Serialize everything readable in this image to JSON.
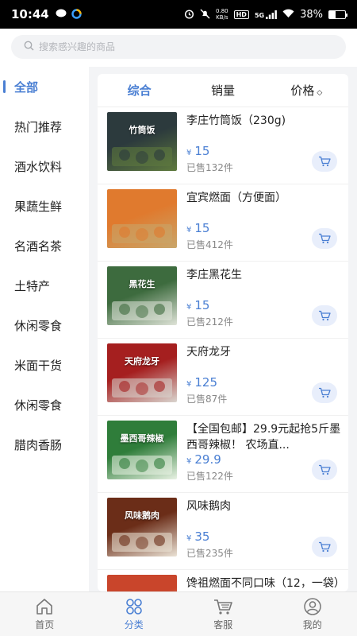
{
  "status_bar": {
    "time": "10:44",
    "net_speed_value": "0.80",
    "net_speed_unit": "KB/s",
    "hd_label": "HD",
    "signal_label": "5G",
    "battery": "38%",
    "battery_level": 0.38
  },
  "search": {
    "placeholder": "搜索感兴趣的商品"
  },
  "sidebar": {
    "items": [
      {
        "label": "全部",
        "active": true
      },
      {
        "label": "热门推荐"
      },
      {
        "label": "酒水饮料"
      },
      {
        "label": "果蔬生鲜"
      },
      {
        "label": "名酒名茶"
      },
      {
        "label": "土特产"
      },
      {
        "label": "休闲零食"
      },
      {
        "label": "米面干货"
      },
      {
        "label": "休闲零食"
      },
      {
        "label": "腊肉香肠"
      }
    ]
  },
  "sort_bar": {
    "tabs": [
      "综合",
      "销量",
      "价格"
    ],
    "price_caret": "◇"
  },
  "products": [
    {
      "title": "李庄竹筒饭（230g)",
      "currency": "¥",
      "price": "15",
      "sold": "已售132件",
      "img_text": "竹筒饭",
      "img_colors": [
        "#2c3a3d",
        "#5f7a3e"
      ]
    },
    {
      "title": "宜宾燃面（方便面）",
      "currency": "¥",
      "price": "15",
      "sold": "已售412件",
      "img_text": "",
      "img_colors": [
        "#e07a2e",
        "#c9a66a"
      ]
    },
    {
      "title": "李庄黑花生",
      "currency": "¥",
      "price": "15",
      "sold": "已售212件",
      "img_text": "黑花生",
      "img_colors": [
        "#3d6b3e",
        "#dfe3d8"
      ]
    },
    {
      "title": "天府龙牙",
      "currency": "¥",
      "price": "125",
      "sold": "已售87件",
      "img_text": "天府龙牙",
      "img_colors": [
        "#a51f1f",
        "#d9d5cf"
      ]
    },
    {
      "title": "【全国包邮】29.9元起抢5斤墨西哥辣椒！ 农场直...",
      "currency": "¥",
      "price": "29.9",
      "sold": "已售122件",
      "img_text": "墨西哥辣椒",
      "img_colors": [
        "#2f7d3a",
        "#e9f2e4"
      ]
    },
    {
      "title": "风味鹅肉",
      "currency": "¥",
      "price": "35",
      "sold": "已售235件",
      "img_text": "风味鹅肉",
      "img_colors": [
        "#6b2d18",
        "#ebe3d6"
      ]
    },
    {
      "title": "馋祖燃面不同口味（12，一袋）",
      "currency": "",
      "price": "",
      "sold": "",
      "img_text": "",
      "img_colors": [
        "#c9452b",
        "#e8d2c0"
      ]
    }
  ],
  "tabbar": {
    "tabs": [
      {
        "label": "首页",
        "icon": "home-icon"
      },
      {
        "label": "分类",
        "icon": "category-icon",
        "active": true
      },
      {
        "label": "客服",
        "icon": "cart-icon"
      },
      {
        "label": "我的",
        "icon": "user-icon"
      }
    ]
  },
  "colors": {
    "accent": "#4a7fd3",
    "cart_bg": "#e8eefb"
  }
}
